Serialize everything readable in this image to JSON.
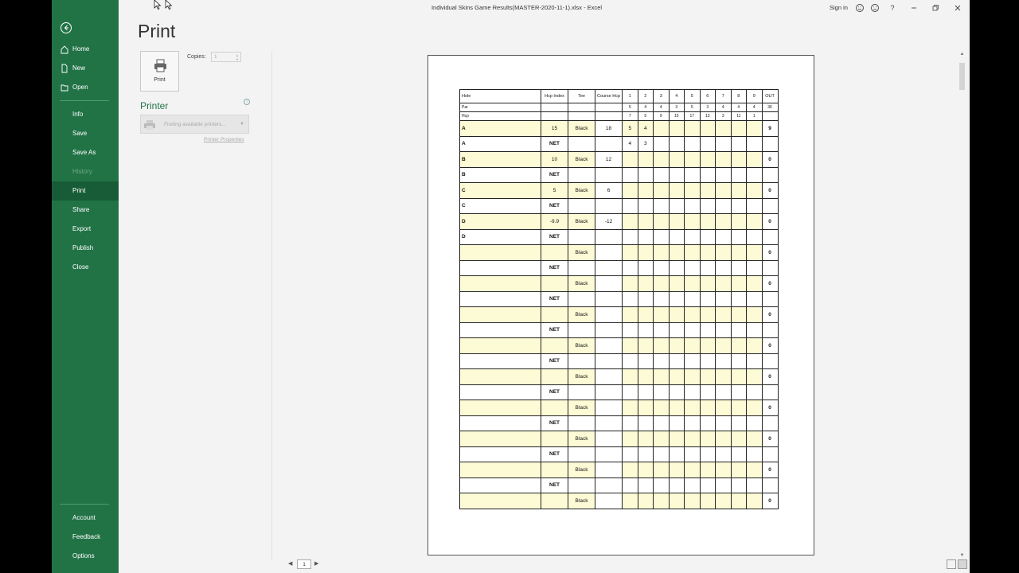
{
  "window": {
    "title": "Individual Skins Game Results(MASTER-2020-11-1).xlsx  -  Excel",
    "sign_in": "Sign in"
  },
  "sidebar": {
    "items": [
      {
        "label": "Home",
        "icon": "home-icon"
      },
      {
        "label": "New",
        "icon": "new-file-icon"
      },
      {
        "label": "Open",
        "icon": "folder-open-icon"
      },
      {
        "label": "Info"
      },
      {
        "label": "Save"
      },
      {
        "label": "Save As"
      },
      {
        "label": "History",
        "disabled": true
      },
      {
        "label": "Print",
        "active": true
      },
      {
        "label": "Share"
      },
      {
        "label": "Export"
      },
      {
        "label": "Publish"
      },
      {
        "label": "Close"
      },
      {
        "label": "Account"
      },
      {
        "label": "Feedback"
      },
      {
        "label": "Options"
      }
    ]
  },
  "print_panel": {
    "heading": "Print",
    "print_button_label": "Print",
    "copies_label": "Copies:",
    "copies_value": "1",
    "printer_heading": "Printer",
    "printer_status": "Finding available printers...",
    "printer_properties": "Printer Properties"
  },
  "pager": {
    "current_page": "1"
  },
  "scorecard": {
    "header": {
      "hole": "Hole",
      "hcp_index": "Hcp Index",
      "tee": "Tee",
      "course_hcp": "Course Hcp",
      "holes": [
        "1",
        "2",
        "3",
        "4",
        "5",
        "6",
        "7",
        "8",
        "9"
      ],
      "out": "OUT"
    },
    "par_row": {
      "label": "Par",
      "values": [
        "5",
        "4",
        "4",
        "3",
        "5",
        "3",
        "4",
        "4",
        "4"
      ],
      "out": "36"
    },
    "hcp_row": {
      "label": "Hcp",
      "values": [
        "7",
        "5",
        "9",
        "15",
        "17",
        "13",
        "3",
        "11",
        "1"
      ],
      "out": ""
    },
    "rows": [
      {
        "name": "A",
        "hcp": "15",
        "tee": "Black",
        "course": "18",
        "scores": [
          "5",
          "4",
          "",
          "",
          "",
          "",
          "",
          "",
          ""
        ],
        "out": "9",
        "yellow": true
      },
      {
        "name": "A",
        "hcp": "NET",
        "tee": "",
        "course": "",
        "scores": [
          "4",
          "3",
          "",
          "",
          "",
          "",
          "",
          "",
          ""
        ],
        "out": "",
        "yellow": false
      },
      {
        "name": "B",
        "hcp": "10",
        "tee": "Black",
        "course": "12",
        "scores": [
          "",
          "",
          "",
          "",
          "",
          "",
          "",
          "",
          ""
        ],
        "out": "0",
        "yellow": true
      },
      {
        "name": "B",
        "hcp": "NET",
        "tee": "",
        "course": "",
        "scores": [
          "",
          "",
          "",
          "",
          "",
          "",
          "",
          "",
          ""
        ],
        "out": "",
        "yellow": false
      },
      {
        "name": "C",
        "hcp": "5",
        "tee": "Black",
        "course": "6",
        "scores": [
          "",
          "",
          "",
          "",
          "",
          "",
          "",
          "",
          ""
        ],
        "out": "0",
        "yellow": true
      },
      {
        "name": "C",
        "hcp": "NET",
        "tee": "",
        "course": "",
        "scores": [
          "",
          "",
          "",
          "",
          "",
          "",
          "",
          "",
          ""
        ],
        "out": "",
        "yellow": false
      },
      {
        "name": "D",
        "hcp": "-9.9",
        "tee": "Black",
        "course": "-12",
        "scores": [
          "",
          "",
          "",
          "",
          "",
          "",
          "",
          "",
          ""
        ],
        "out": "0",
        "yellow": true
      },
      {
        "name": "D",
        "hcp": "NET",
        "tee": "",
        "course": "",
        "scores": [
          "",
          "",
          "",
          "",
          "",
          "",
          "",
          "",
          ""
        ],
        "out": "",
        "yellow": false
      },
      {
        "name": "",
        "hcp": "",
        "tee": "Black",
        "course": "",
        "scores": [
          "",
          "",
          "",
          "",
          "",
          "",
          "",
          "",
          ""
        ],
        "out": "0",
        "yellow": true
      },
      {
        "name": "",
        "hcp": "NET",
        "tee": "",
        "course": "",
        "scores": [
          "",
          "",
          "",
          "",
          "",
          "",
          "",
          "",
          ""
        ],
        "out": "",
        "yellow": false
      },
      {
        "name": "",
        "hcp": "",
        "tee": "Black",
        "course": "",
        "scores": [
          "",
          "",
          "",
          "",
          "",
          "",
          "",
          "",
          ""
        ],
        "out": "0",
        "yellow": true
      },
      {
        "name": "",
        "hcp": "NET",
        "tee": "",
        "course": "",
        "scores": [
          "",
          "",
          "",
          "",
          "",
          "",
          "",
          "",
          ""
        ],
        "out": "",
        "yellow": false
      },
      {
        "name": "",
        "hcp": "",
        "tee": "Black",
        "course": "",
        "scores": [
          "",
          "",
          "",
          "",
          "",
          "",
          "",
          "",
          ""
        ],
        "out": "0",
        "yellow": true
      },
      {
        "name": "",
        "hcp": "NET",
        "tee": "",
        "course": "",
        "scores": [
          "",
          "",
          "",
          "",
          "",
          "",
          "",
          "",
          ""
        ],
        "out": "",
        "yellow": false
      },
      {
        "name": "",
        "hcp": "",
        "tee": "Black",
        "course": "",
        "scores": [
          "",
          "",
          "",
          "",
          "",
          "",
          "",
          "",
          ""
        ],
        "out": "0",
        "yellow": true
      },
      {
        "name": "",
        "hcp": "NET",
        "tee": "",
        "course": "",
        "scores": [
          "",
          "",
          "",
          "",
          "",
          "",
          "",
          "",
          ""
        ],
        "out": "",
        "yellow": false
      },
      {
        "name": "",
        "hcp": "",
        "tee": "Black",
        "course": "",
        "scores": [
          "",
          "",
          "",
          "",
          "",
          "",
          "",
          "",
          ""
        ],
        "out": "0",
        "yellow": true
      },
      {
        "name": "",
        "hcp": "NET",
        "tee": "",
        "course": "",
        "scores": [
          "",
          "",
          "",
          "",
          "",
          "",
          "",
          "",
          ""
        ],
        "out": "",
        "yellow": false
      },
      {
        "name": "",
        "hcp": "",
        "tee": "Black",
        "course": "",
        "scores": [
          "",
          "",
          "",
          "",
          "",
          "",
          "",
          "",
          ""
        ],
        "out": "0",
        "yellow": true
      },
      {
        "name": "",
        "hcp": "NET",
        "tee": "",
        "course": "",
        "scores": [
          "",
          "",
          "",
          "",
          "",
          "",
          "",
          "",
          ""
        ],
        "out": "",
        "yellow": false
      },
      {
        "name": "",
        "hcp": "",
        "tee": "Black",
        "course": "",
        "scores": [
          "",
          "",
          "",
          "",
          "",
          "",
          "",
          "",
          ""
        ],
        "out": "0",
        "yellow": true
      },
      {
        "name": "",
        "hcp": "NET",
        "tee": "",
        "course": "",
        "scores": [
          "",
          "",
          "",
          "",
          "",
          "",
          "",
          "",
          ""
        ],
        "out": "",
        "yellow": false
      },
      {
        "name": "",
        "hcp": "",
        "tee": "Black",
        "course": "",
        "scores": [
          "",
          "",
          "",
          "",
          "",
          "",
          "",
          "",
          ""
        ],
        "out": "0",
        "yellow": true
      },
      {
        "name": "",
        "hcp": "NET",
        "tee": "",
        "course": "",
        "scores": [
          "",
          "",
          "",
          "",
          "",
          "",
          "",
          "",
          ""
        ],
        "out": "",
        "yellow": false
      },
      {
        "name": "",
        "hcp": "",
        "tee": "Black",
        "course": "",
        "scores": [
          "",
          "",
          "",
          "",
          "",
          "",
          "",
          "",
          ""
        ],
        "out": "0",
        "yellow": true
      }
    ]
  },
  "colors": {
    "sidebar_bg": "#217346",
    "sidebar_active": "#185c37",
    "accent": "#217346",
    "cell_yellow": "#fdfbd6"
  }
}
